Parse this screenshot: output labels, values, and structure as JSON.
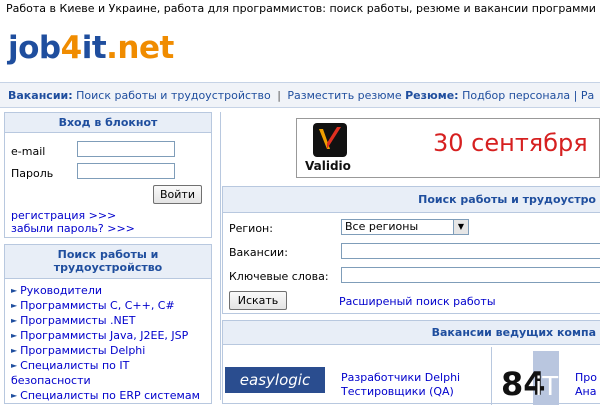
{
  "top_line": "Работа в Киеве и Украине, работа для программистов: поиск работы, резюме и вакансии программи",
  "logo": {
    "job": "job",
    "four": "4",
    "it": "it",
    "net": ".net"
  },
  "nav": {
    "vacancies_label": "Вакансии:",
    "link_search": "Поиск работы и трудоустройство",
    "sep": "|",
    "link_post_resume": "Разместить резюме",
    "resume_label": "Резюме:",
    "link_staff": "Подбор персонала",
    "trailing": "| Ра"
  },
  "login": {
    "title": "Вход в блокнот",
    "email_label": "e-mail",
    "password_label": "Пароль",
    "submit": "Войти",
    "register_link": "регистрация >>>",
    "forgot_link": "забыли пароль? >>>"
  },
  "left_search": {
    "title_line1": "Поиск работы и",
    "title_line2": "трудоустройство",
    "items": [
      "Руководители",
      "Программисты C, C++, C#",
      "Программисты .NET",
      "Программисты Java, J2EE, JSP",
      "Программисты Delphi",
      "Специалисты по IT безопасности",
      "Специалисты по ERP системам"
    ]
  },
  "banner": {
    "brand": "Validio",
    "date": "30 сентября"
  },
  "job_search": {
    "title": "Поиск работы и трудоустро",
    "region_label": "Регион:",
    "region_value": "Все регионы",
    "vacancy_label": "Вакансии:",
    "keywords_label": "Ключевые слова:",
    "search_button": "Искать",
    "advanced_link": "Расширеный поиск работы"
  },
  "leading_vacancies": {
    "title": "Вакансии ведущих компа",
    "company1_logo": "easylogic",
    "company1_line1": "Разработчики Delphi",
    "company1_line2": "Тестировщики (QA)",
    "company2_line1": "Про",
    "company2_line2": "Ана"
  },
  "colors": {
    "brand_blue": "#1f4e9e",
    "brand_orange": "#f08c00",
    "banner_red": "#d62020"
  }
}
